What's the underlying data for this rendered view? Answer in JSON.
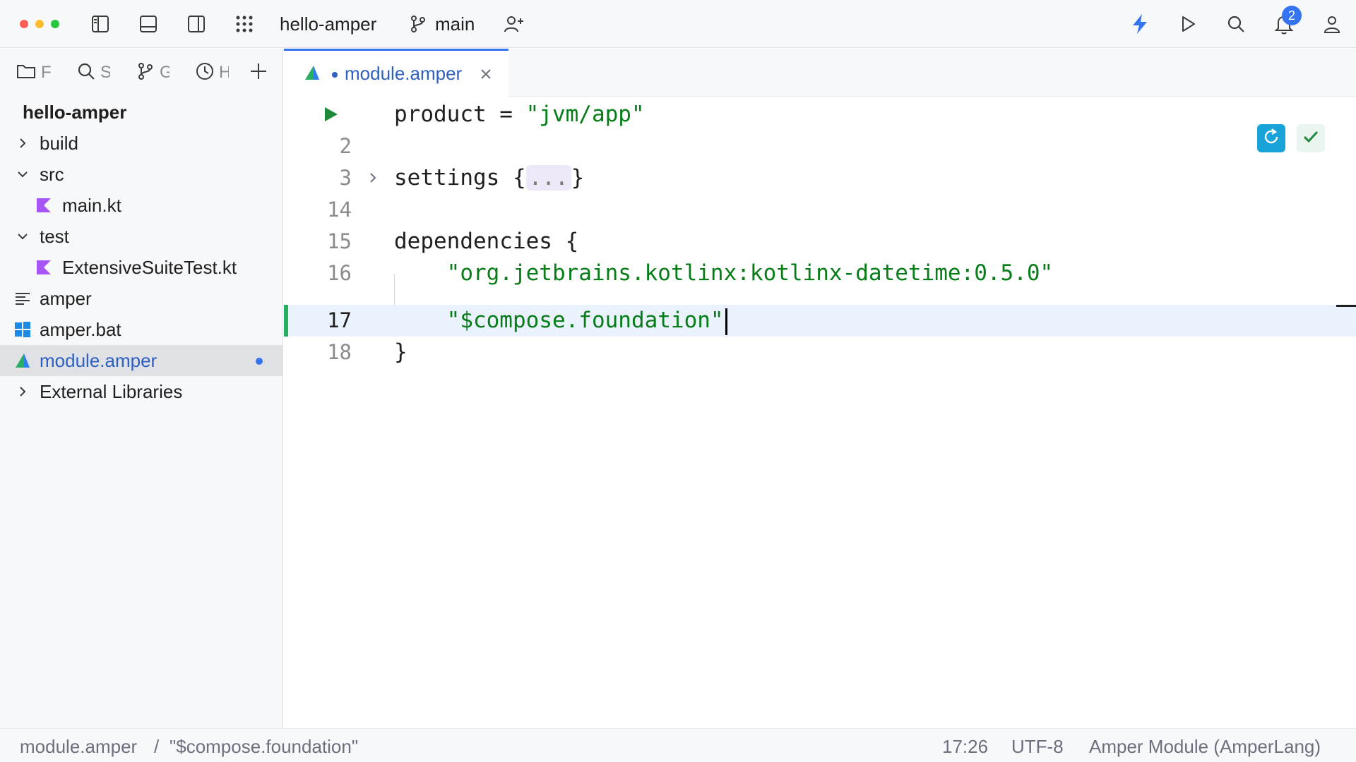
{
  "titlebar": {
    "project_name": "hello-amper",
    "branch": "main",
    "notification_count": "2",
    "colors": {
      "close": "#ff5f57",
      "minimize": "#febc2e",
      "zoom": "#28c840",
      "accent": "#3574f0"
    }
  },
  "side_tabs": [
    {
      "icon": "folder-icon",
      "label": "F"
    },
    {
      "icon": "search-icon",
      "label": "S"
    },
    {
      "icon": "git-branch-icon",
      "label": "G"
    },
    {
      "icon": "clock-icon",
      "label": "H"
    }
  ],
  "tree": {
    "root": "hello-amper",
    "items": [
      {
        "label": "build",
        "type": "folder",
        "expanded": false
      },
      {
        "label": "src",
        "type": "folder",
        "expanded": true
      },
      {
        "label": "main.kt",
        "type": "kotlin-file"
      },
      {
        "label": "test",
        "type": "folder",
        "expanded": true
      },
      {
        "label": "ExtensiveSuiteTest.kt",
        "type": "kotlin-file"
      },
      {
        "label": "amper",
        "type": "text-file"
      },
      {
        "label": "amper.bat",
        "type": "windows-file"
      },
      {
        "label": "module.amper",
        "type": "amper-file",
        "selected": true,
        "modified": true
      },
      {
        "label": "External Libraries",
        "type": "folder",
        "expanded": false
      }
    ]
  },
  "editor": {
    "tab_label": "module.amper",
    "lines": [
      {
        "number": "",
        "code": "product = ",
        "string": "\"jvm/app\""
      },
      {
        "number": "2",
        "code": ""
      },
      {
        "number": "3",
        "code": "settings {",
        "fold": "...",
        "close": "}"
      },
      {
        "number": "14",
        "code": ""
      },
      {
        "number": "15",
        "code": "dependencies {"
      },
      {
        "number": "16",
        "indent": "    ",
        "string": "\"org.jetbrains.kotlinx:kotlinx-datetime:0.5.0\""
      },
      {
        "number": "17",
        "indent": "    ",
        "string": "\"$compose.foundation\""
      },
      {
        "number": "18",
        "code": "}"
      }
    ]
  },
  "status": {
    "breadcrumb_file": "module.amper",
    "breadcrumb_sep": "/",
    "breadcrumb_item": "\"$compose.foundation\"",
    "position": "17:26",
    "encoding": "UTF-8",
    "file_type": "Amper Module (AmperLang)"
  }
}
